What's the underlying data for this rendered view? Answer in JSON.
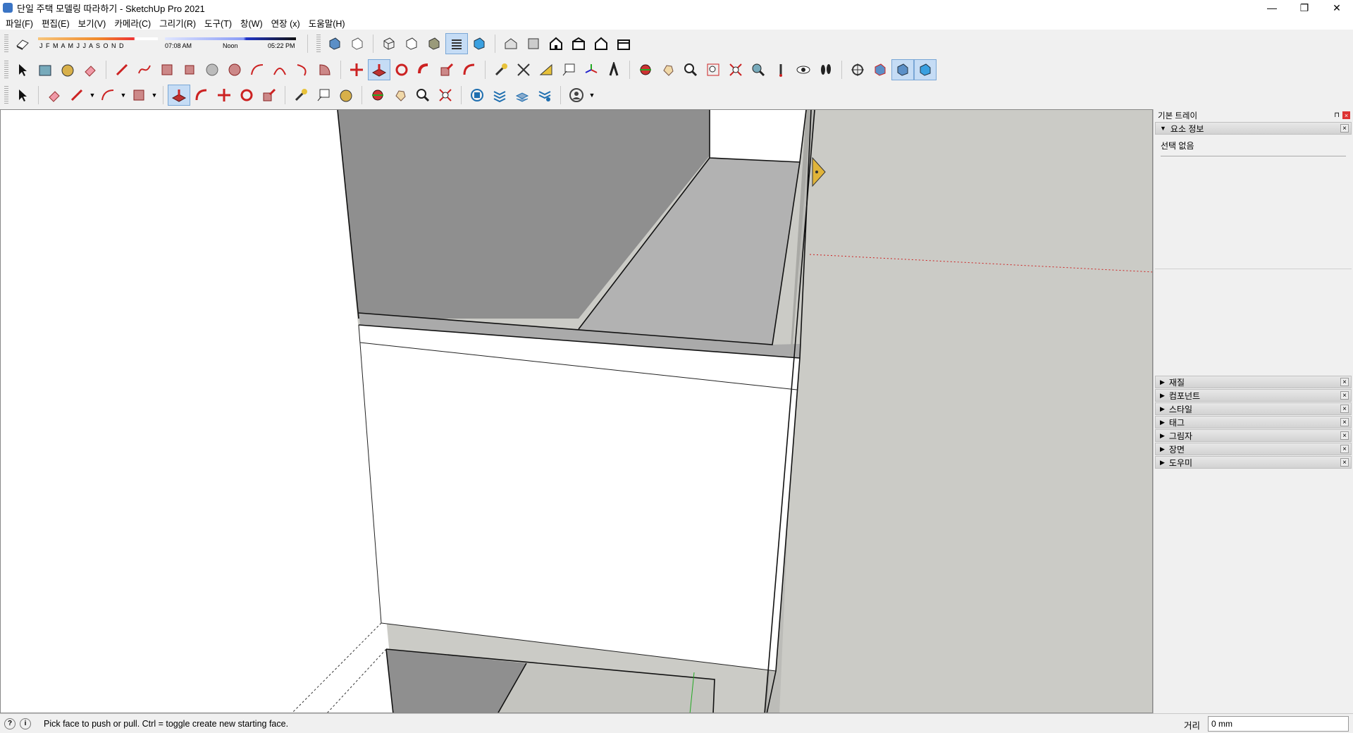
{
  "window": {
    "title": "단일 주택 모델링 따라하기 - SketchUp Pro 2021",
    "controls": {
      "minimize": "—",
      "restore": "❐",
      "close": "✕"
    }
  },
  "menu": [
    "파일(F)",
    "편집(E)",
    "보기(V)",
    "카메라(C)",
    "그리기(R)",
    "도구(T)",
    "창(W)",
    "연장 (x)",
    "도움말(H)"
  ],
  "shadows": {
    "months": "J F M A M J J A S O N D",
    "time_start": "07:08 AM",
    "time_mid": "Noon",
    "time_end": "05:22 PM"
  },
  "tray": {
    "title": "기본 트레이",
    "pin": "⊓",
    "close": "×",
    "entity_info": {
      "label": "요소 정보",
      "selection": "선택 없음"
    },
    "panels": [
      "재질",
      "컴포넌트",
      "스타일",
      "태그",
      "그림자",
      "장면",
      "도우미"
    ]
  },
  "status": {
    "message": "Pick face to push or pull.  Ctrl = toggle create new starting face.",
    "measure_label": "거리",
    "measure_value": "0 mm"
  },
  "colors": {
    "active_tool": "#c5dcf5",
    "viewport_face_gray": "#cbcbc6",
    "shadow_dark": "#8f8f8f"
  }
}
